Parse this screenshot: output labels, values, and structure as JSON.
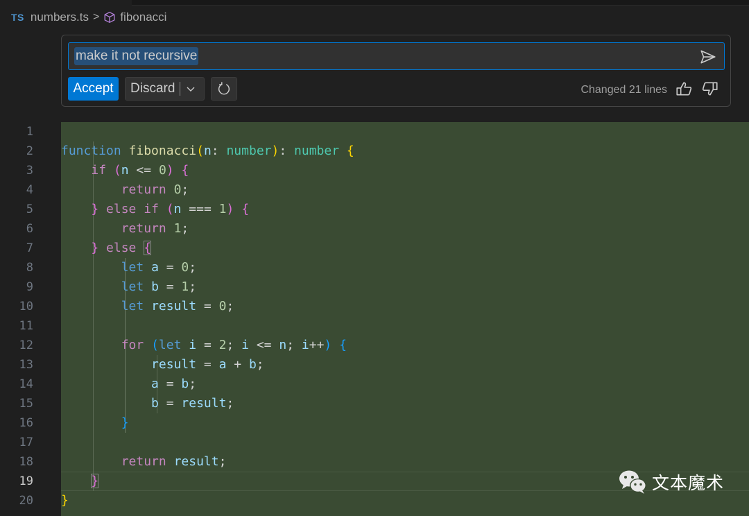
{
  "breadcrumb": {
    "language_badge": "TS",
    "file": "numbers.ts",
    "separator": ">",
    "symbol": "fibonacci"
  },
  "inline_chat": {
    "prompt_value": "make it not recursive",
    "accept_label": "Accept",
    "discard_label": "Discard",
    "status": "Changed 21 lines"
  },
  "editor": {
    "active_line": 19,
    "line_numbers": [
      "1",
      "2",
      "3",
      "4",
      "5",
      "6",
      "7",
      "8",
      "9",
      "10",
      "11",
      "12",
      "13",
      "14",
      "15",
      "16",
      "17",
      "18",
      "19",
      "20"
    ],
    "code_lines": [
      "",
      "function fibonacci(n: number): number {",
      "    if (n <= 0) {",
      "        return 0;",
      "    } else if (n === 1) {",
      "        return 1;",
      "    } else {",
      "        let a = 0;",
      "        let b = 1;",
      "        let result = 0;",
      "",
      "        for (let i = 2; i <= n; i++) {",
      "            result = a + b;",
      "            a = b;",
      "            b = result;",
      "        }",
      "",
      "        return result;",
      "    }",
      "}"
    ]
  },
  "colors": {
    "accent": "#0078d4",
    "diff_added_bg": "#3a4b33",
    "editor_bg": "#1f1f1f"
  },
  "watermark": {
    "text": "文本魔术"
  }
}
